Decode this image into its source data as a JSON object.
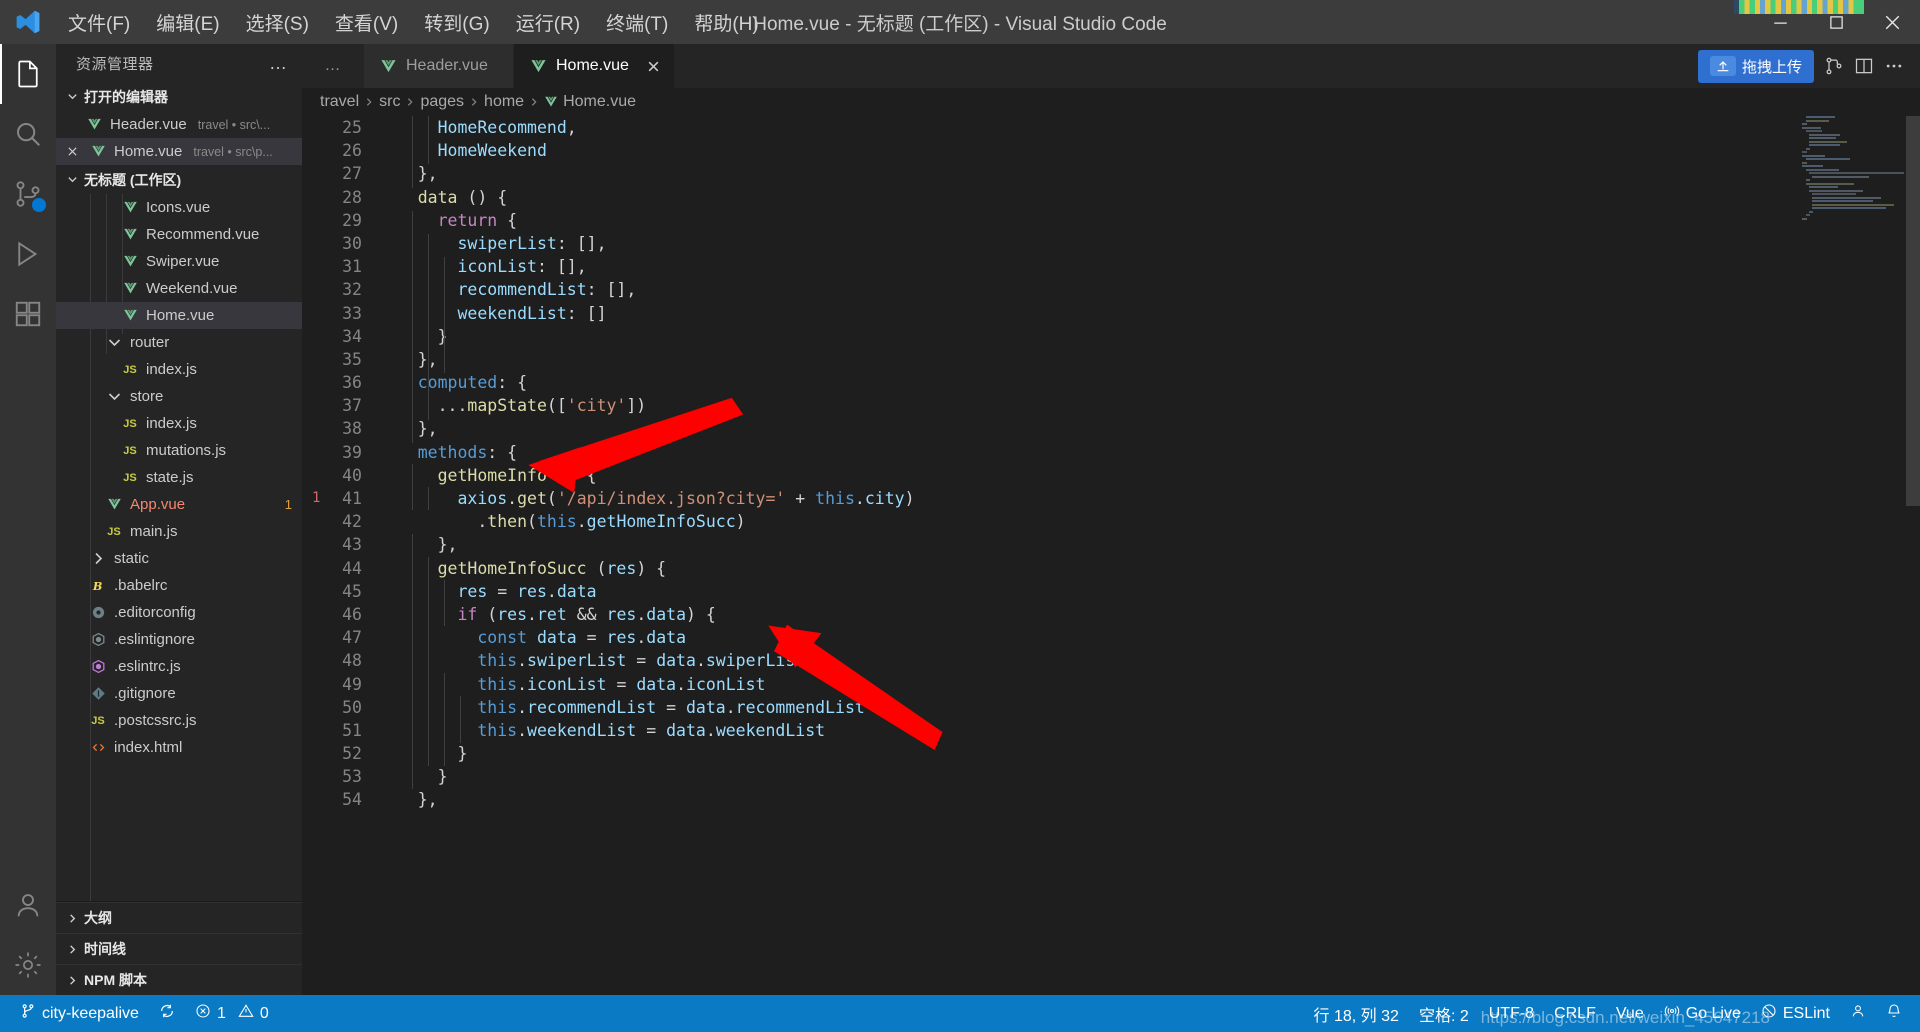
{
  "titlebar": {
    "app_title": "Home.vue - 无标题 (工作区) - Visual Studio Code",
    "menu": [
      "文件(F)",
      "编辑(E)",
      "选择(S)",
      "查看(V)",
      "转到(G)",
      "运行(R)",
      "终端(T)",
      "帮助(H)"
    ]
  },
  "activitybar": {
    "items": [
      {
        "name": "explorer",
        "badge": ""
      },
      {
        "name": "search",
        "badge": ""
      },
      {
        "name": "source-control",
        "badge": ""
      },
      {
        "name": "run-debug",
        "badge": ""
      },
      {
        "name": "extensions",
        "badge": ""
      },
      {
        "name": "accounts",
        "badge": ""
      },
      {
        "name": "settings",
        "badge": ""
      }
    ]
  },
  "sidebar": {
    "title": "资源管理器",
    "more_label": "…",
    "open_editors": {
      "label": "打开的编辑器",
      "items": [
        {
          "name": "Header.vue",
          "path": "travel • src\\...",
          "icon": "vue-icon",
          "closable": false,
          "selected": false
        },
        {
          "name": "Home.vue",
          "path": "travel • src\\p...",
          "icon": "vue-icon",
          "closable": true,
          "selected": true
        }
      ]
    },
    "workspace": {
      "label": "无标题 (工作区)",
      "files": [
        {
          "name": "Icons.vue",
          "icon": "vue-icon",
          "indent": 4,
          "selected": false,
          "color": "#cccccc",
          "badge": ""
        },
        {
          "name": "Recommend.vue",
          "icon": "vue-icon",
          "indent": 4,
          "selected": false,
          "color": "#cccccc",
          "badge": ""
        },
        {
          "name": "Swiper.vue",
          "icon": "vue-icon",
          "indent": 4,
          "selected": false,
          "color": "#cccccc",
          "badge": ""
        },
        {
          "name": "Weekend.vue",
          "icon": "vue-icon",
          "indent": 4,
          "selected": false,
          "color": "#cccccc",
          "badge": ""
        },
        {
          "name": "Home.vue",
          "icon": "vue-icon",
          "indent": 4,
          "selected": true,
          "color": "#cccccc",
          "badge": ""
        },
        {
          "name": "router",
          "icon": "folder-open-icon",
          "indent": 3,
          "selected": false,
          "color": "#cccccc",
          "badge": ""
        },
        {
          "name": "index.js",
          "icon": "js-icon",
          "indent": 4,
          "selected": false,
          "color": "#cccccc",
          "badge": ""
        },
        {
          "name": "store",
          "icon": "folder-open-icon",
          "indent": 3,
          "selected": false,
          "color": "#cccccc",
          "badge": ""
        },
        {
          "name": "index.js",
          "icon": "js-icon",
          "indent": 4,
          "selected": false,
          "color": "#cccccc",
          "badge": ""
        },
        {
          "name": "mutations.js",
          "icon": "js-icon",
          "indent": 4,
          "selected": false,
          "color": "#cccccc",
          "badge": ""
        },
        {
          "name": "state.js",
          "icon": "js-icon",
          "indent": 4,
          "selected": false,
          "color": "#cccccc",
          "badge": ""
        },
        {
          "name": "App.vue",
          "icon": "vue-icon",
          "indent": 3,
          "selected": false,
          "color": "#f48771",
          "badge": "1"
        },
        {
          "name": "main.js",
          "icon": "js-icon",
          "indent": 3,
          "selected": false,
          "color": "#cccccc",
          "badge": ""
        },
        {
          "name": "static",
          "icon": "folder-closed-icon",
          "indent": 2,
          "selected": false,
          "color": "#cccccc",
          "badge": ""
        },
        {
          "name": ".babelrc",
          "icon": "babel-icon",
          "indent": 2,
          "selected": false,
          "color": "#cccccc",
          "badge": ""
        },
        {
          "name": ".editorconfig",
          "icon": "gear-icon",
          "indent": 2,
          "selected": false,
          "color": "#cccccc",
          "badge": ""
        },
        {
          "name": ".eslintignore",
          "icon": "eslint-gray-icon",
          "indent": 2,
          "selected": false,
          "color": "#cccccc",
          "badge": ""
        },
        {
          "name": ".eslintrc.js",
          "icon": "eslint-purple-icon",
          "indent": 2,
          "selected": false,
          "color": "#cccccc",
          "badge": ""
        },
        {
          "name": ".gitignore",
          "icon": "git-icon",
          "indent": 2,
          "selected": false,
          "color": "#cccccc",
          "badge": ""
        },
        {
          "name": ".postcssrc.js",
          "icon": "js-icon",
          "indent": 2,
          "selected": false,
          "color": "#cccccc",
          "badge": ""
        },
        {
          "name": "index.html",
          "icon": "html-icon",
          "indent": 2,
          "selected": false,
          "color": "#cccccc",
          "badge": ""
        }
      ]
    },
    "panels": [
      {
        "label": "大纲"
      },
      {
        "label": "时间线"
      },
      {
        "label": "NPM 脚本"
      }
    ]
  },
  "tabs": {
    "items": [
      {
        "label": "Header.vue",
        "icon": "vue-icon",
        "active": false,
        "closable": false
      },
      {
        "label": "Home.vue",
        "icon": "vue-icon",
        "active": true,
        "closable": true
      }
    ],
    "overflow_label": "…",
    "upload_button": "拖拽上传",
    "actions": [
      "split-editor-icon",
      "more-actions-icon"
    ]
  },
  "breadcrumb": {
    "items": [
      "travel",
      "src",
      "pages",
      "home",
      "Home.vue"
    ]
  },
  "editor": {
    "first_line_number": 24,
    "lines": [
      {
        "n": 25,
        "tokens": [
          {
            "t": "      ",
            "c": "t-plain"
          },
          {
            "t": "HomeRecommend",
            "c": "t-prop"
          },
          {
            "t": ",",
            "c": "t-punct"
          }
        ]
      },
      {
        "n": 26,
        "tokens": [
          {
            "t": "      ",
            "c": "t-plain"
          },
          {
            "t": "HomeWeekend",
            "c": "t-prop"
          }
        ]
      },
      {
        "n": 27,
        "tokens": [
          {
            "t": "    },",
            "c": "t-punct"
          }
        ]
      },
      {
        "n": 28,
        "tokens": [
          {
            "t": "    ",
            "c": "t-plain"
          },
          {
            "t": "data",
            "c": "t-fn"
          },
          {
            "t": " () {",
            "c": "t-punct"
          }
        ]
      },
      {
        "n": 29,
        "tokens": [
          {
            "t": "      ",
            "c": "t-plain"
          },
          {
            "t": "return",
            "c": "t-pink"
          },
          {
            "t": " {",
            "c": "t-punct"
          }
        ]
      },
      {
        "n": 30,
        "tokens": [
          {
            "t": "        ",
            "c": "t-plain"
          },
          {
            "t": "swiperList",
            "c": "t-prop"
          },
          {
            "t": ": [],",
            "c": "t-punct"
          }
        ]
      },
      {
        "n": 31,
        "tokens": [
          {
            "t": "        ",
            "c": "t-plain"
          },
          {
            "t": "iconList",
            "c": "t-prop"
          },
          {
            "t": ": [],",
            "c": "t-punct"
          }
        ]
      },
      {
        "n": 32,
        "tokens": [
          {
            "t": "        ",
            "c": "t-plain"
          },
          {
            "t": "recommendList",
            "c": "t-prop"
          },
          {
            "t": ": [],",
            "c": "t-punct"
          }
        ]
      },
      {
        "n": 33,
        "tokens": [
          {
            "t": "        ",
            "c": "t-plain"
          },
          {
            "t": "weekendList",
            "c": "t-prop"
          },
          {
            "t": ": []",
            "c": "t-punct"
          }
        ]
      },
      {
        "n": 34,
        "tokens": [
          {
            "t": "      }",
            "c": "t-punct"
          }
        ]
      },
      {
        "n": 35,
        "tokens": [
          {
            "t": "    },",
            "c": "t-punct"
          }
        ]
      },
      {
        "n": 36,
        "tokens": [
          {
            "t": "    ",
            "c": "t-plain"
          },
          {
            "t": "computed",
            "c": "t-key"
          },
          {
            "t": ": {",
            "c": "t-punct"
          }
        ]
      },
      {
        "n": 37,
        "tokens": [
          {
            "t": "      ...",
            "c": "t-punct"
          },
          {
            "t": "mapState",
            "c": "t-fn"
          },
          {
            "t": "([",
            "c": "t-punct"
          },
          {
            "t": "'city'",
            "c": "t-str"
          },
          {
            "t": "])",
            "c": "t-punct"
          }
        ]
      },
      {
        "n": 38,
        "tokens": [
          {
            "t": "    },",
            "c": "t-punct"
          }
        ]
      },
      {
        "n": 39,
        "tokens": [
          {
            "t": "    ",
            "c": "t-plain"
          },
          {
            "t": "methods",
            "c": "t-key"
          },
          {
            "t": ": {",
            "c": "t-punct"
          }
        ]
      },
      {
        "n": 40,
        "tokens": [
          {
            "t": "      ",
            "c": "t-plain"
          },
          {
            "t": "getHomeInfo",
            "c": "t-fn"
          },
          {
            "t": " () {",
            "c": "t-punct"
          }
        ]
      },
      {
        "n": 41,
        "tokens": [
          {
            "t": "        ",
            "c": "t-plain"
          },
          {
            "t": "axios",
            "c": "t-prop"
          },
          {
            "t": ".",
            "c": "t-punct"
          },
          {
            "t": "get",
            "c": "t-fn"
          },
          {
            "t": "(",
            "c": "t-punct"
          },
          {
            "t": "'/api/index.json?city='",
            "c": "t-str"
          },
          {
            "t": " + ",
            "c": "t-punct"
          },
          {
            "t": "this",
            "c": "t-key"
          },
          {
            "t": ".",
            "c": "t-punct"
          },
          {
            "t": "city",
            "c": "t-prop"
          },
          {
            "t": ")",
            "c": "t-punct"
          }
        ]
      },
      {
        "n": 42,
        "tokens": [
          {
            "t": "          .",
            "c": "t-punct"
          },
          {
            "t": "then",
            "c": "t-fn"
          },
          {
            "t": "(",
            "c": "t-punct"
          },
          {
            "t": "this",
            "c": "t-key"
          },
          {
            "t": ".",
            "c": "t-punct"
          },
          {
            "t": "getHomeInfoSucc",
            "c": "t-prop"
          },
          {
            "t": ")",
            "c": "t-punct"
          }
        ]
      },
      {
        "n": 43,
        "tokens": [
          {
            "t": "      },",
            "c": "t-punct"
          }
        ]
      },
      {
        "n": 44,
        "tokens": [
          {
            "t": "      ",
            "c": "t-plain"
          },
          {
            "t": "getHomeInfoSucc",
            "c": "t-fn"
          },
          {
            "t": " (",
            "c": "t-punct"
          },
          {
            "t": "res",
            "c": "t-prop"
          },
          {
            "t": ") {",
            "c": "t-punct"
          }
        ]
      },
      {
        "n": 45,
        "tokens": [
          {
            "t": "        ",
            "c": "t-plain"
          },
          {
            "t": "res",
            "c": "t-prop"
          },
          {
            "t": " = ",
            "c": "t-punct"
          },
          {
            "t": "res",
            "c": "t-prop"
          },
          {
            "t": ".",
            "c": "t-punct"
          },
          {
            "t": "data",
            "c": "t-prop"
          }
        ]
      },
      {
        "n": 46,
        "tokens": [
          {
            "t": "        ",
            "c": "t-plain"
          },
          {
            "t": "if",
            "c": "t-pink"
          },
          {
            "t": " (",
            "c": "t-punct"
          },
          {
            "t": "res",
            "c": "t-prop"
          },
          {
            "t": ".",
            "c": "t-punct"
          },
          {
            "t": "ret",
            "c": "t-prop"
          },
          {
            "t": " && ",
            "c": "t-punct"
          },
          {
            "t": "res",
            "c": "t-prop"
          },
          {
            "t": ".",
            "c": "t-punct"
          },
          {
            "t": "data",
            "c": "t-prop"
          },
          {
            "t": ") {",
            "c": "t-punct"
          }
        ]
      },
      {
        "n": 47,
        "tokens": [
          {
            "t": "          ",
            "c": "t-plain"
          },
          {
            "t": "const",
            "c": "t-key"
          },
          {
            "t": " ",
            "c": "t-plain"
          },
          {
            "t": "data",
            "c": "t-prop"
          },
          {
            "t": " = ",
            "c": "t-punct"
          },
          {
            "t": "res",
            "c": "t-prop"
          },
          {
            "t": ".",
            "c": "t-punct"
          },
          {
            "t": "data",
            "c": "t-prop"
          }
        ]
      },
      {
        "n": 48,
        "tokens": [
          {
            "t": "          ",
            "c": "t-plain"
          },
          {
            "t": "this",
            "c": "t-key"
          },
          {
            "t": ".",
            "c": "t-punct"
          },
          {
            "t": "swiperList",
            "c": "t-prop"
          },
          {
            "t": " = ",
            "c": "t-punct"
          },
          {
            "t": "data",
            "c": "t-prop"
          },
          {
            "t": ".",
            "c": "t-punct"
          },
          {
            "t": "swiperList",
            "c": "t-prop"
          }
        ]
      },
      {
        "n": 49,
        "tokens": [
          {
            "t": "          ",
            "c": "t-plain"
          },
          {
            "t": "this",
            "c": "t-key"
          },
          {
            "t": ".",
            "c": "t-punct"
          },
          {
            "t": "iconList",
            "c": "t-prop"
          },
          {
            "t": " = ",
            "c": "t-punct"
          },
          {
            "t": "data",
            "c": "t-prop"
          },
          {
            "t": ".",
            "c": "t-punct"
          },
          {
            "t": "iconList",
            "c": "t-prop"
          }
        ]
      },
      {
        "n": 50,
        "tokens": [
          {
            "t": "          ",
            "c": "t-plain"
          },
          {
            "t": "this",
            "c": "t-key"
          },
          {
            "t": ".",
            "c": "t-punct"
          },
          {
            "t": "recommendList",
            "c": "t-prop"
          },
          {
            "t": " = ",
            "c": "t-punct"
          },
          {
            "t": "data",
            "c": "t-prop"
          },
          {
            "t": ".",
            "c": "t-punct"
          },
          {
            "t": "recommendList",
            "c": "t-prop"
          }
        ]
      },
      {
        "n": 51,
        "tokens": [
          {
            "t": "          ",
            "c": "t-plain"
          },
          {
            "t": "this",
            "c": "t-key"
          },
          {
            "t": ".",
            "c": "t-punct"
          },
          {
            "t": "weekendList",
            "c": "t-prop"
          },
          {
            "t": " = ",
            "c": "t-punct"
          },
          {
            "t": "data",
            "c": "t-prop"
          },
          {
            "t": ".",
            "c": "t-punct"
          },
          {
            "t": "weekendList",
            "c": "t-prop"
          }
        ]
      },
      {
        "n": 52,
        "tokens": [
          {
            "t": "        }",
            "c": "t-punct"
          }
        ]
      },
      {
        "n": 53,
        "tokens": [
          {
            "t": "      }",
            "c": "t-punct"
          }
        ]
      },
      {
        "n": 54,
        "tokens": [
          {
            "t": "    },",
            "c": "t-punct"
          }
        ]
      }
    ],
    "error_marker_line": 41,
    "error_marker_text": "1"
  },
  "statusbar": {
    "branch": "city-keepalive",
    "errors": "1",
    "warnings": "0",
    "cursor": "行 18, 列 32",
    "spaces": "空格: 2",
    "encoding": "UTF-8",
    "eol": "CRLF",
    "language": "Vue",
    "golive": "Go Live",
    "eslint": "ESLint",
    "watermark": "https://blog.csdn.net/weixin_45647218"
  },
  "colors": {
    "accent": "#0a7ac4",
    "vue_green": "#7ec699",
    "error_red": "#f48771",
    "arrow_red": "#ff0000",
    "titlebar_bg": "#3c3c3c",
    "sidebar_bg": "#252526",
    "editor_bg": "#1e1e1e"
  }
}
